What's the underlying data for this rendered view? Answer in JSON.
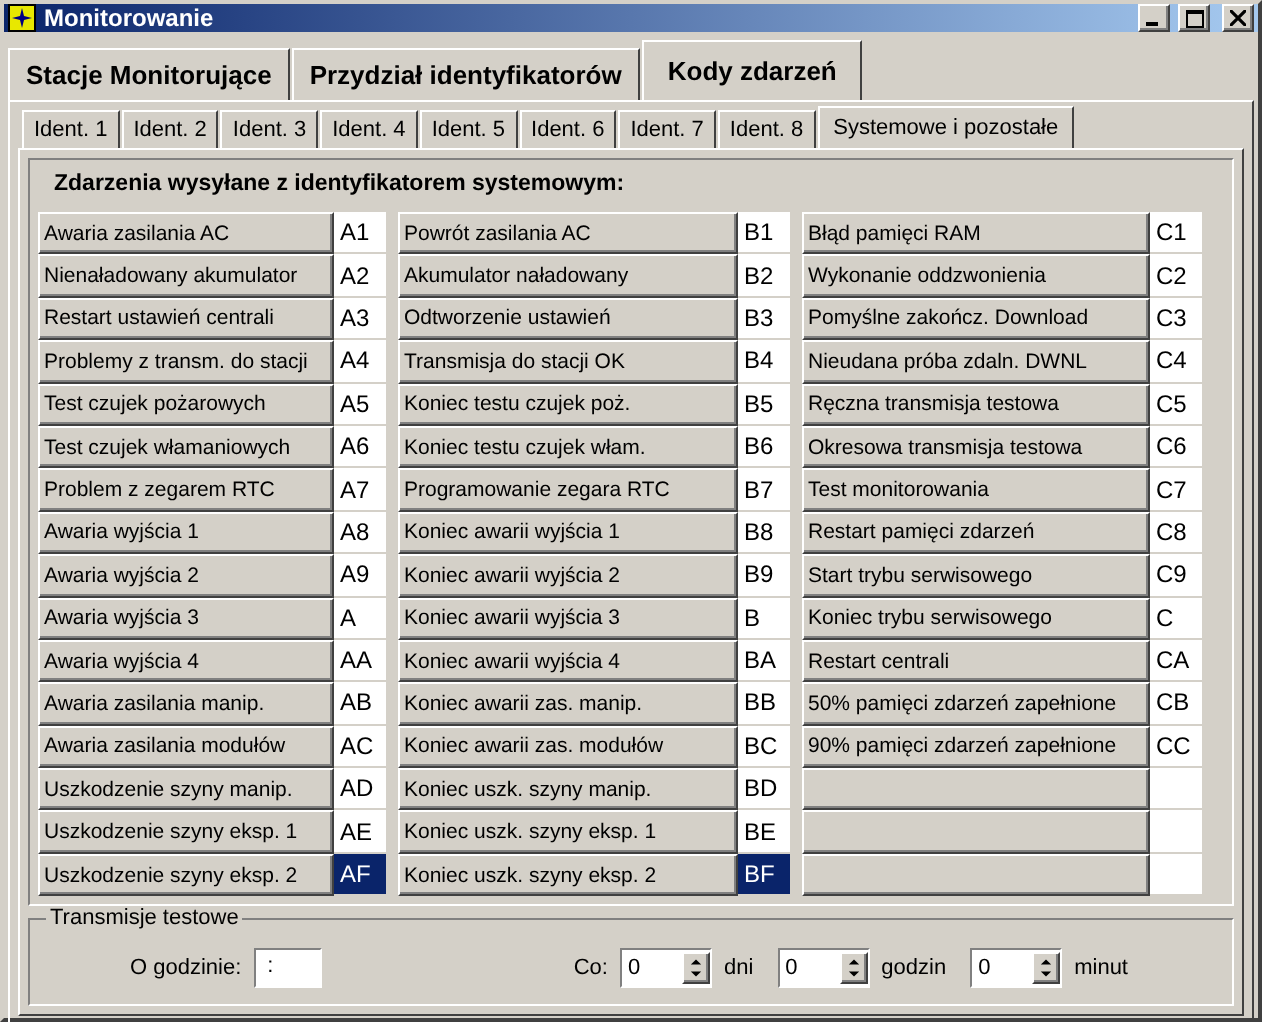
{
  "window": {
    "title": "Monitorowanie"
  },
  "main_tabs": [
    {
      "label": "Stacje Monitorujące",
      "selected": false
    },
    {
      "label": "Przydział identyfikatorów",
      "selected": false
    },
    {
      "label": "Kody zdarzeń",
      "selected": true
    }
  ],
  "sub_tabs": [
    {
      "label": "Ident. 1",
      "selected": false
    },
    {
      "label": "Ident. 2",
      "selected": false
    },
    {
      "label": "Ident. 3",
      "selected": false
    },
    {
      "label": "Ident. 4",
      "selected": false
    },
    {
      "label": "Ident. 5",
      "selected": false
    },
    {
      "label": "Ident. 6",
      "selected": false
    },
    {
      "label": "Ident. 7",
      "selected": false
    },
    {
      "label": "Ident. 8",
      "selected": false
    },
    {
      "label": "Systemowe i pozostałe",
      "selected": true
    }
  ],
  "events_group": {
    "title": "Zdarzenia wysyłane z identyfikatorem systemowym:",
    "columns": [
      [
        {
          "label": "Awaria zasilania AC",
          "code": "A1",
          "selected": false
        },
        {
          "label": "Nienaładowany akumulator",
          "code": "A2",
          "selected": false
        },
        {
          "label": "Restart ustawień centrali",
          "code": "A3",
          "selected": false
        },
        {
          "label": "Problemy z transm. do stacji",
          "code": "A4",
          "selected": false
        },
        {
          "label": "Test czujek pożarowych",
          "code": "A5",
          "selected": false
        },
        {
          "label": "Test czujek włamaniowych",
          "code": "A6",
          "selected": false
        },
        {
          "label": "Problem z zegarem RTC",
          "code": "A7",
          "selected": false
        },
        {
          "label": "Awaria wyjścia 1",
          "code": "A8",
          "selected": false
        },
        {
          "label": "Awaria wyjścia 2",
          "code": "A9",
          "selected": false
        },
        {
          "label": "Awaria wyjścia 3",
          "code": "A",
          "selected": false
        },
        {
          "label": "Awaria wyjścia 4",
          "code": "AA",
          "selected": false
        },
        {
          "label": "Awaria zasilania manip.",
          "code": "AB",
          "selected": false
        },
        {
          "label": "Awaria zasilania modułów",
          "code": "AC",
          "selected": false
        },
        {
          "label": "Uszkodzenie szyny manip.",
          "code": "AD",
          "selected": false
        },
        {
          "label": "Uszkodzenie szyny eksp. 1",
          "code": "AE",
          "selected": false
        },
        {
          "label": "Uszkodzenie szyny eksp. 2",
          "code": "AF",
          "selected": true
        }
      ],
      [
        {
          "label": "Powrót zasilania AC",
          "code": "B1",
          "selected": false
        },
        {
          "label": "Akumulator naładowany",
          "code": "B2",
          "selected": false
        },
        {
          "label": "Odtworzenie ustawień",
          "code": "B3",
          "selected": false
        },
        {
          "label": "Transmisja do stacji OK",
          "code": "B4",
          "selected": false
        },
        {
          "label": "Koniec testu czujek poż.",
          "code": "B5",
          "selected": false
        },
        {
          "label": "Koniec testu czujek włam.",
          "code": "B6",
          "selected": false
        },
        {
          "label": "Programowanie zegara RTC",
          "code": "B7",
          "selected": false
        },
        {
          "label": "Koniec awarii wyjścia 1",
          "code": "B8",
          "selected": false
        },
        {
          "label": "Koniec awarii wyjścia 2",
          "code": "B9",
          "selected": false
        },
        {
          "label": "Koniec awarii wyjścia 3",
          "code": "B",
          "selected": false
        },
        {
          "label": "Koniec awarii wyjścia 4",
          "code": "BA",
          "selected": false
        },
        {
          "label": "Koniec awarii zas. manip.",
          "code": "BB",
          "selected": false
        },
        {
          "label": "Koniec awarii zas. modułów",
          "code": "BC",
          "selected": false
        },
        {
          "label": "Koniec uszk. szyny manip.",
          "code": "BD",
          "selected": false
        },
        {
          "label": "Koniec uszk. szyny eksp. 1",
          "code": "BE",
          "selected": false
        },
        {
          "label": "Koniec uszk. szyny eksp. 2",
          "code": "BF",
          "selected": true
        }
      ],
      [
        {
          "label": "Błąd pamięci RAM",
          "code": "C1",
          "selected": false
        },
        {
          "label": "Wykonanie oddzwonienia",
          "code": "C2",
          "selected": false
        },
        {
          "label": "Pomyślne zakończ. Download",
          "code": "C3",
          "selected": false
        },
        {
          "label": "Nieudana próba zdaln. DWNL",
          "code": "C4",
          "selected": false
        },
        {
          "label": "Ręczna transmisja testowa",
          "code": "C5",
          "selected": false
        },
        {
          "label": "Okresowa transmisja testowa",
          "code": "C6",
          "selected": false
        },
        {
          "label": "Test monitorowania",
          "code": "C7",
          "selected": false
        },
        {
          "label": "Restart pamięci zdarzeń",
          "code": "C8",
          "selected": false
        },
        {
          "label": "Start trybu serwisowego",
          "code": "C9",
          "selected": false
        },
        {
          "label": "Koniec trybu serwisowego",
          "code": "C",
          "selected": false
        },
        {
          "label": "Restart centrali",
          "code": "CA",
          "selected": false
        },
        {
          "label": "50% pamięci zdarzeń zapełnione",
          "code": "CB",
          "selected": false
        },
        {
          "label": "90% pamięci zdarzeń zapełnione",
          "code": "CC",
          "selected": false
        },
        {
          "selected": false
        },
        {
          "selected": false
        },
        {
          "selected": false
        }
      ]
    ]
  },
  "test_group": {
    "title": "Transmisje testowe",
    "time_label": "O godzinie:",
    "time_value": ":",
    "every_label": "Co:",
    "spinners": [
      {
        "value": "0",
        "unit": "dni"
      },
      {
        "value": "0",
        "unit": "godzin"
      },
      {
        "value": "0",
        "unit": "minut"
      }
    ]
  }
}
